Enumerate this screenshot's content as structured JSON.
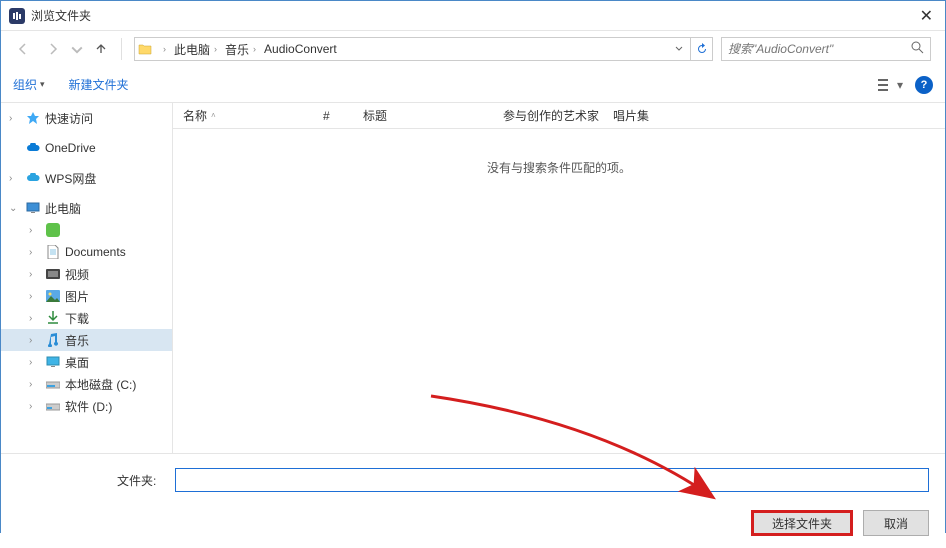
{
  "window": {
    "title": "浏览文件夹"
  },
  "nav": {
    "path_root": "此电脑",
    "path_mid": "音乐",
    "path_leaf": "AudioConvert",
    "search_placeholder": "搜索\"AudioConvert\""
  },
  "toolbar": {
    "organize": "组织",
    "new_folder": "新建文件夹"
  },
  "sidebar": {
    "quick_access": "快速访问",
    "onedrive": "OneDrive",
    "wps": "WPS网盘",
    "this_pc": "此电脑",
    "documents": "Documents",
    "videos": "视频",
    "pictures": "图片",
    "downloads": "下载",
    "music": "音乐",
    "desktop": "桌面",
    "local_c": "本地磁盘 (C:)",
    "drive_d": "软件 (D:)"
  },
  "columns": {
    "name": "名称",
    "number": "#",
    "title": "标题",
    "artist": "参与创作的艺术家",
    "album": "唱片集"
  },
  "content": {
    "empty": "没有与搜索条件匹配的项。"
  },
  "footer": {
    "folder_label": "文件夹:",
    "select": "选择文件夹",
    "cancel": "取消"
  }
}
